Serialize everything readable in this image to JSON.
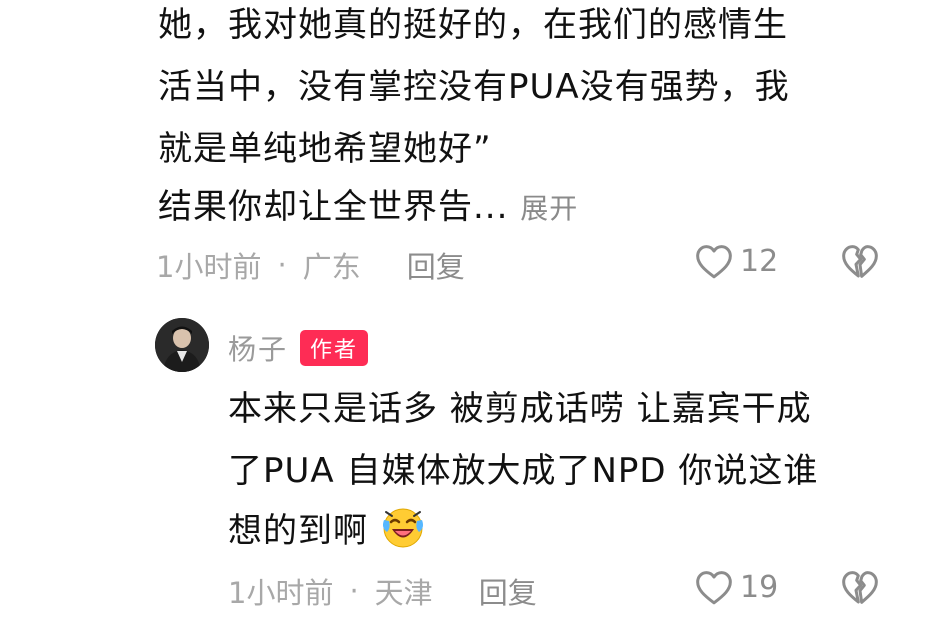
{
  "comment1": {
    "lines": [
      "她，我对她真的挺好的，在我们的感情生",
      "活当中，没有掌控没有PUA没有强势，我",
      "就是单纯地希望她好”"
    ],
    "truncated_line": "结果你却让全世界告...",
    "expand_label": "展开",
    "time": "1小时前",
    "dot": "·",
    "location": "广东",
    "reply_label": "回复",
    "likes": "12"
  },
  "reply1": {
    "username": "杨子",
    "badge": "作者",
    "lines": [
      "本来只是话多 被剪成话唠 让嘉宾干成",
      "了PUA 自媒体放大成了NPD 你说这谁",
      "想的到啊"
    ],
    "emoji": "laughing-crying-emoji",
    "time": "1小时前",
    "dot": "·",
    "location": "天津",
    "reply_label": "回复",
    "likes": "19"
  },
  "colors": {
    "text": "#111111",
    "meta": "#a8a8a8",
    "badge": "#fe2c55"
  }
}
